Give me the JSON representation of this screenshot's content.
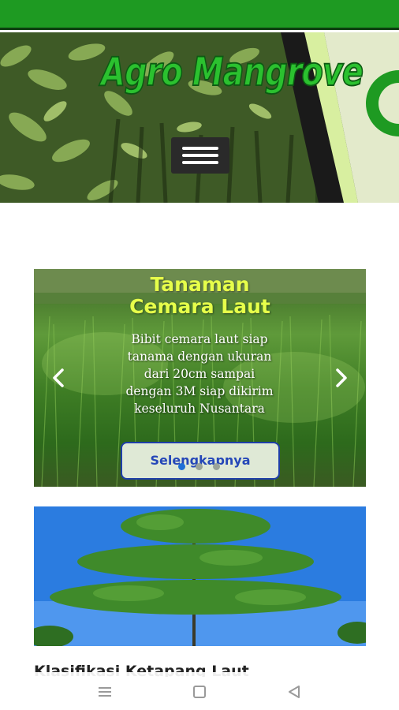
{
  "header": {
    "logo_text": "Agro Mangrove",
    "menu_icon": "hamburger-icon"
  },
  "slider": {
    "title_line1": "Tanaman",
    "title_line2": "Cemara Laut",
    "description_lines": [
      "Bibit cemara laut siap",
      "tanama dengan ukuran",
      "dari 20cm sampai",
      "dengan 3M siap dikirim",
      "keseluruh Nusantara"
    ],
    "cta_label": "Selengkapnya",
    "prev_icon": "chevron-left-icon",
    "next_icon": "chevron-right-icon",
    "slide_count": 3,
    "active_slide": 1
  },
  "article": {
    "heading_partial": "Klasifikasi Ketapang Laut"
  },
  "system_nav": {
    "recents_icon": "menu-lines-icon",
    "home_icon": "square-home-icon",
    "back_icon": "triangle-back-icon"
  },
  "colors": {
    "status_bar": "#1e9a22",
    "logo_green": "#2bc12f",
    "title_yellow": "#e6ff4a",
    "cta_text": "#2547b8",
    "dot_active": "#1f6fd6"
  }
}
